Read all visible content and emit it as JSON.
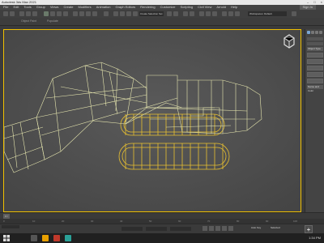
{
  "title": "Autodesk 3ds Max 2021",
  "window_controls": [
    "–",
    "□",
    "×"
  ],
  "menu": [
    "File",
    "Edit",
    "Tools",
    "Group",
    "Views",
    "Create",
    "Modifiers",
    "Animation",
    "Graph Editors",
    "Rendering",
    "Customize",
    "Scripting",
    "Civil View",
    "Arnold",
    "Help"
  ],
  "signin_label": "Sign In",
  "toolbar": {
    "selection_set": "Create Selection Set",
    "workspace": "Workspaces: Default"
  },
  "ribbon": {
    "object_paint": "Object Paint",
    "populate": "Populate"
  },
  "viewport_label": "[+] [Perspective] [Standard] [Default Shading]",
  "viewport": {
    "wire_color": "#e8e8b0",
    "track_color": "#e8c030"
  },
  "command_panel": {
    "header": "Object Type",
    "header2": "Name and Color"
  },
  "timeline": {
    "slider": "0 / 100"
  },
  "track_ticks": [
    "0",
    "10",
    "20",
    "30",
    "40",
    "50",
    "60",
    "70",
    "80",
    "90",
    "100"
  ],
  "status": {
    "autokey": "Auto Key",
    "selected": "Selected"
  },
  "taskbar": {
    "time": "1:34 PM"
  }
}
